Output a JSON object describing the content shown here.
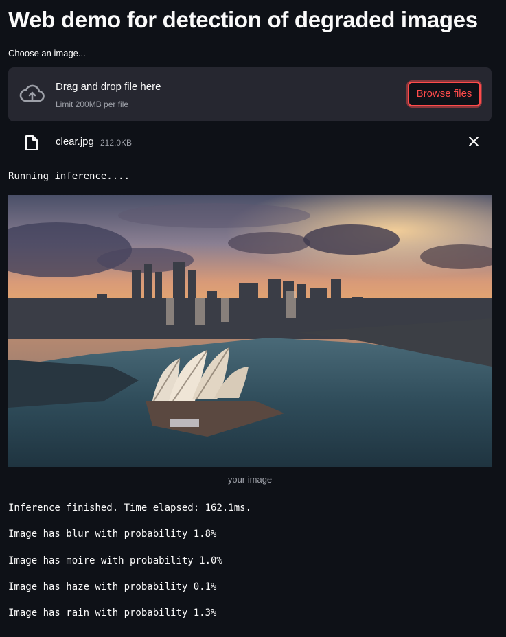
{
  "page": {
    "title": "Web demo for detection of degraded images"
  },
  "uploader": {
    "label": "Choose an image...",
    "drop_text": "Drag and drop file here",
    "limit_text": "Limit 200MB per file",
    "browse_label": "Browse files",
    "cloud_icon": "cloud-upload-icon",
    "accent_color": "#ff4b4b"
  },
  "uploaded_file": {
    "name": "clear.jpg",
    "size": "212.0KB",
    "file_icon": "file-icon",
    "remove_icon": "close-icon"
  },
  "status": {
    "running": "Running inference....",
    "finished": "Inference finished. Time elapsed: 162.1ms."
  },
  "image": {
    "caption": "your image",
    "subject": "aerial view of a harbour city skyline with an opera house at sunset"
  },
  "results": [
    "Image has blur with probability 1.8%",
    "Image has moire with probability 1.0%",
    "Image has haze with probability 0.1%",
    "Image has rain with probability 1.3%"
  ]
}
